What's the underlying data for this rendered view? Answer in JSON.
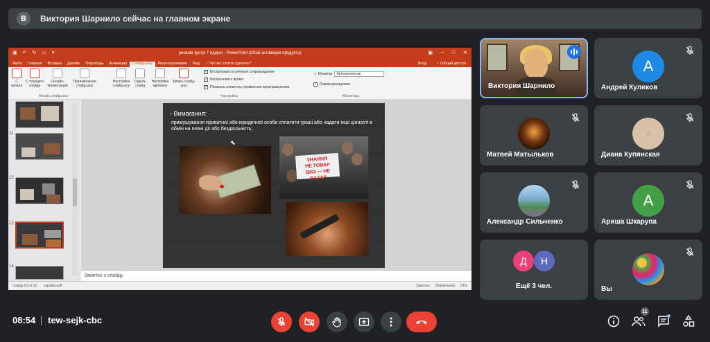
{
  "presenter_banner": {
    "avatar_letter": "В",
    "text": "Виктория Шарнило сейчас на главном экране"
  },
  "powerpoint": {
    "window_title": "ринкові зустрі 7 грудня - PowerPoint (Сбой активации продукта)",
    "tabs": [
      "Файл",
      "Главная",
      "Вставка",
      "Дизайн",
      "Переходы",
      "Анимация",
      "Слайд-шоу",
      "Рецензирование",
      "Вид",
      "♀ Что вы хотите сделать?"
    ],
    "active_tab": "Слайд-шоу",
    "tabs_right": [
      "Вход",
      "♀ Общий доступ"
    ],
    "ribbon": {
      "btn_from_start": "С начала",
      "btn_from_current": "С текущего слайда",
      "btn_online": "Онлайн-презентация",
      "btn_custom": "Произвольное слайд-шоу",
      "group_start": "Начать слайд-шоу",
      "btn_setup": "Настройка слайд-шоу",
      "btn_hide": "Скрыть слайд",
      "btn_rehearse": "Настройка времени",
      "btn_record": "Запись слайд-шоу",
      "chk_narration": "Воспроизвести речевое сопровождение",
      "chk_timings": "Использовать время",
      "chk_controls": "Показать элементы управления проигрывателем",
      "group_setup": "Настройка",
      "monitor_label": "Монитор:",
      "monitor_value": "Автоматически",
      "chk_presenter": "Режим докладчика",
      "group_monitors": "Мониторы"
    },
    "slide_numbers": [
      "",
      "11",
      "12",
      "13",
      "14"
    ],
    "slide": {
      "heading": "-   Вимагання:",
      "body": "примушування приватної або юридичної особи сплатити гроші або надати інші цінності в обмін на певні дії або бездіяльність;",
      "sign_text_1": "ЗНАННЯ",
      "sign_text_2": "НЕ ТОВАР",
      "sign_text_3": "ВИЗ — НЕ",
      "sign_text_4": "БАЗАР"
    },
    "notes_placeholder": "Заметки к слайду",
    "status": {
      "slide_count": "Слайд 13 из 22",
      "lang": "украинский",
      "notes": "Заметки",
      "comments": "Примечания",
      "zoom": "61%"
    }
  },
  "participants": [
    {
      "name": "Виктория Шарнило",
      "type": "video",
      "speaking": true
    },
    {
      "name": "Андрей Куликов",
      "type": "letter",
      "letter": "А",
      "color": "#1e88e5"
    },
    {
      "name": "Матвей Матыльков",
      "type": "photo"
    },
    {
      "name": "Диана Купянская",
      "type": "photo"
    },
    {
      "name": "Александр Сильченко",
      "type": "photo"
    },
    {
      "name": "Ариша Шкарупа",
      "type": "letter",
      "letter": "А",
      "color": "#43a047"
    },
    {
      "name": "Ещё 3 чел.",
      "type": "group",
      "letters": [
        "Д",
        "Н"
      ]
    },
    {
      "name": "Вы",
      "type": "photo"
    }
  ],
  "meeting": {
    "time": "08:54",
    "code": "tew-sejk-cbc",
    "participants_count": "11"
  },
  "colors": {
    "accent_red": "#ea4335",
    "ppt_orange": "#c43e1c",
    "speaking_blue": "#1a73e8",
    "tile_bg": "#3c4043"
  }
}
